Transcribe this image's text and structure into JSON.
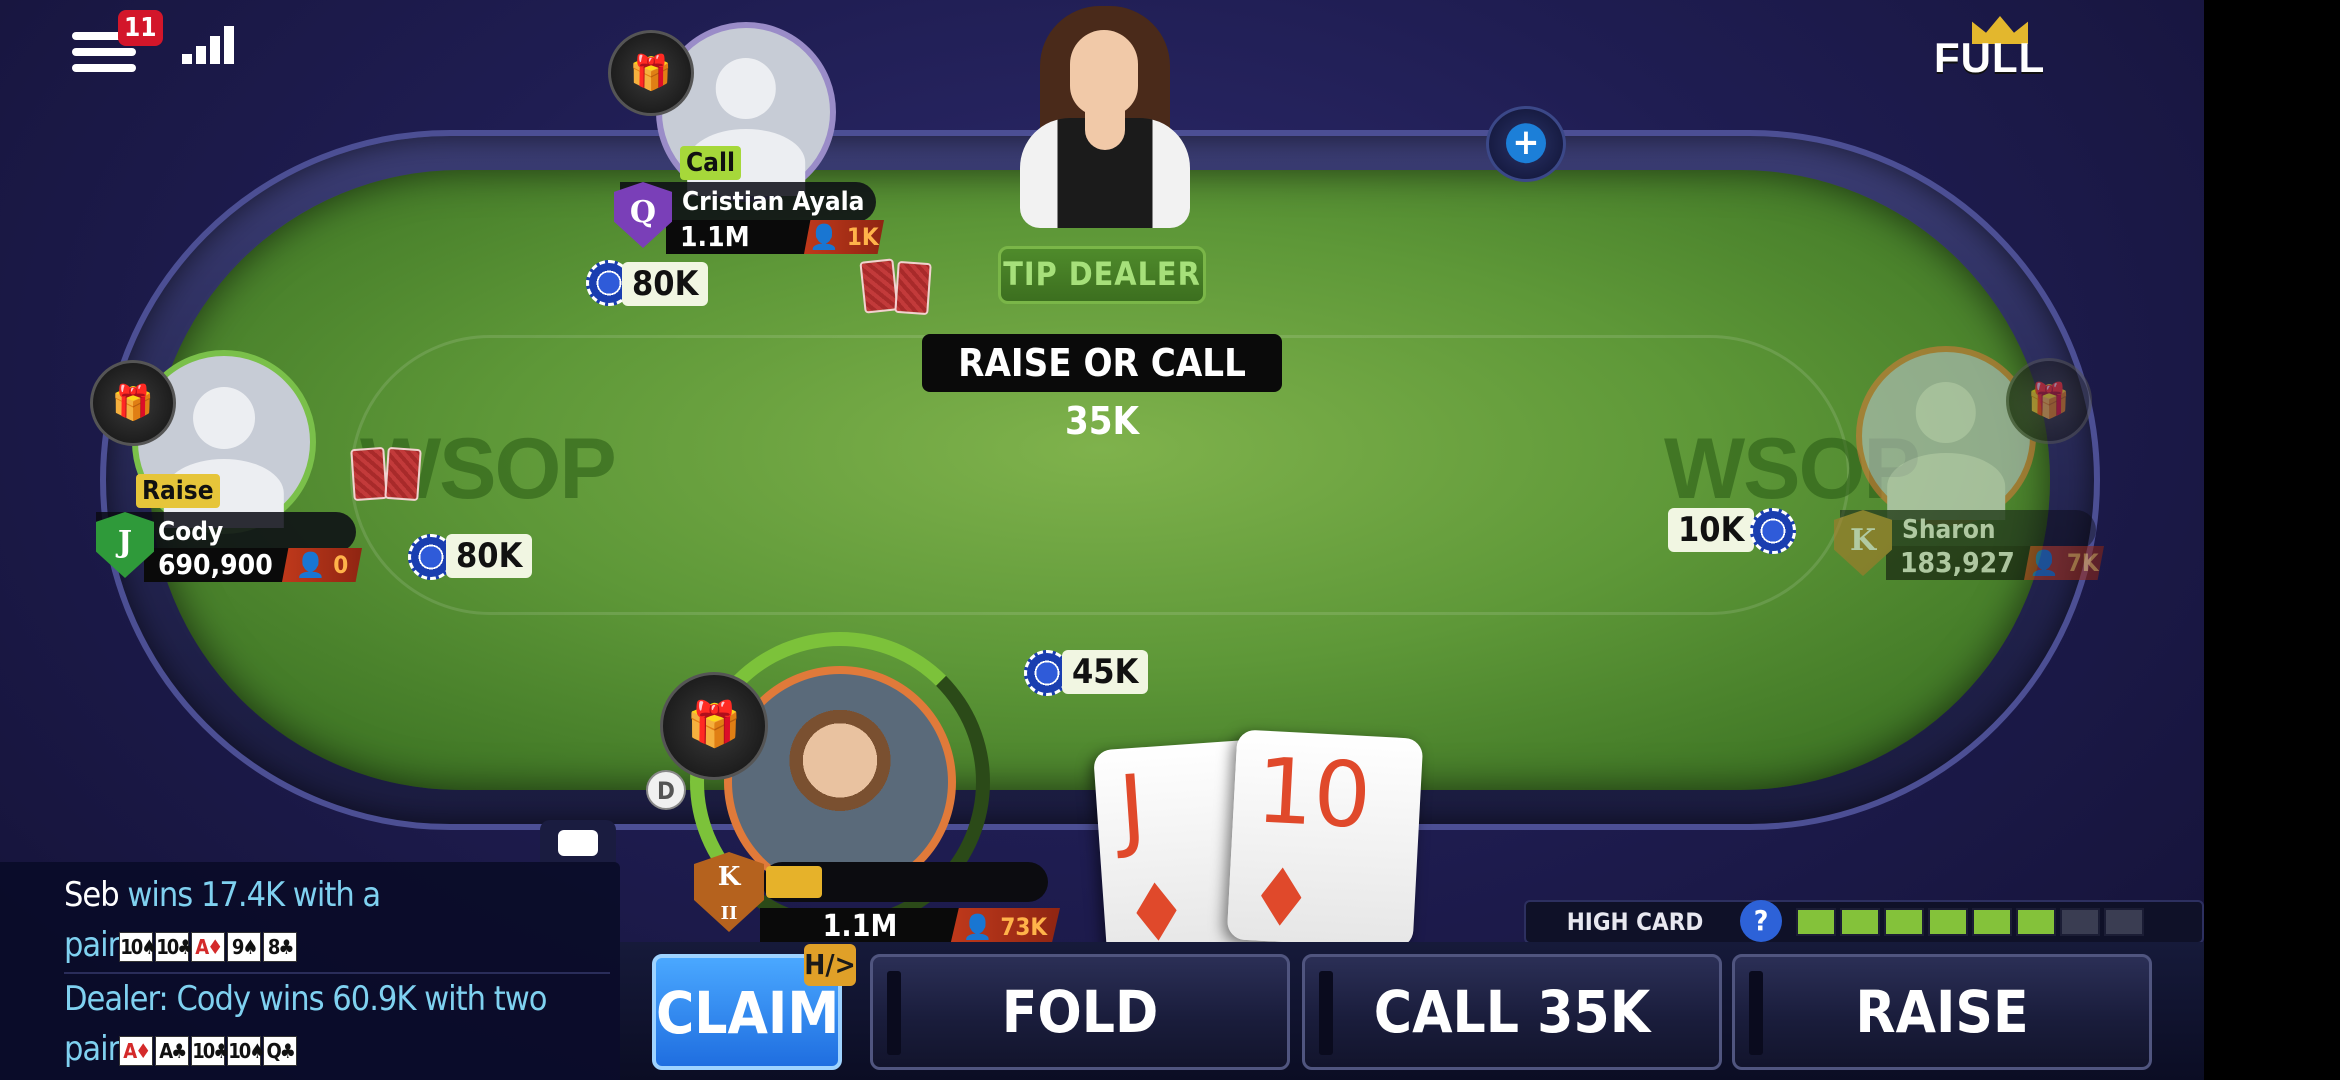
{
  "top_bar": {
    "menu_badge": "11",
    "full_label": "FULL"
  },
  "table": {
    "watermark_left": "WSOP",
    "watermark_right": "WSOP",
    "tip_dealer_label": "TIP DEALER",
    "action_banner": "RAISE OR CALL 35K"
  },
  "players": {
    "top": {
      "name": "Cristian Ayala",
      "action": "Call",
      "stack": "1.1M",
      "bounty": "1K",
      "rank_letter": "Q",
      "bet": "80K"
    },
    "left": {
      "name": "Cody",
      "action": "Raise",
      "stack": "690,900",
      "bounty": "0",
      "rank_letter": "J",
      "bet": "80K"
    },
    "right": {
      "name": "Sharon",
      "stack": "183,927",
      "bounty": "7K",
      "rank_letter": "K",
      "bet": "10K"
    },
    "hero": {
      "stack": "1.1M",
      "bounty": "73K",
      "rank_letter": "K",
      "rank_sub": "II",
      "bet": "45K",
      "dealer_button": "D",
      "xp_fraction": 0.2,
      "cards": [
        {
          "rank": "J",
          "suit": "♦"
        },
        {
          "rank": "10",
          "suit": "♦"
        }
      ]
    }
  },
  "chat": {
    "lines": [
      {
        "who": "Seb",
        "text": " wins 17.4K with a",
        "tail": "pair",
        "cards": [
          {
            "r": "10",
            "s": "♠",
            "red": false
          },
          {
            "r": "10",
            "s": "♣",
            "red": false
          },
          {
            "r": "A",
            "s": "♦",
            "red": true
          },
          {
            "r": "9",
            "s": "♠",
            "red": false
          },
          {
            "r": "8",
            "s": "♣",
            "red": false
          }
        ]
      },
      {
        "who": "",
        "text": "Dealer: Cody wins 60.9K with two",
        "tail": "pair",
        "cards": [
          {
            "r": "A",
            "s": "♦",
            "red": true
          },
          {
            "r": "A",
            "s": "♣",
            "red": false
          },
          {
            "r": "10",
            "s": "♣",
            "red": false
          },
          {
            "r": "10",
            "s": "♠",
            "red": false
          },
          {
            "r": "Q",
            "s": "♣",
            "red": false
          }
        ]
      }
    ]
  },
  "hand_strength": {
    "label": "HIGH CARD",
    "help": "?",
    "level": 6,
    "max": 8
  },
  "actions": {
    "hh_badge": "H/>",
    "claim": "CLAIM",
    "fold": "FOLD",
    "call": "CALL 35K",
    "raise": "RAISE"
  },
  "colors": {
    "felt": "#5e9838",
    "claim": "#1f6ee0",
    "bounty": "#c0391b"
  }
}
